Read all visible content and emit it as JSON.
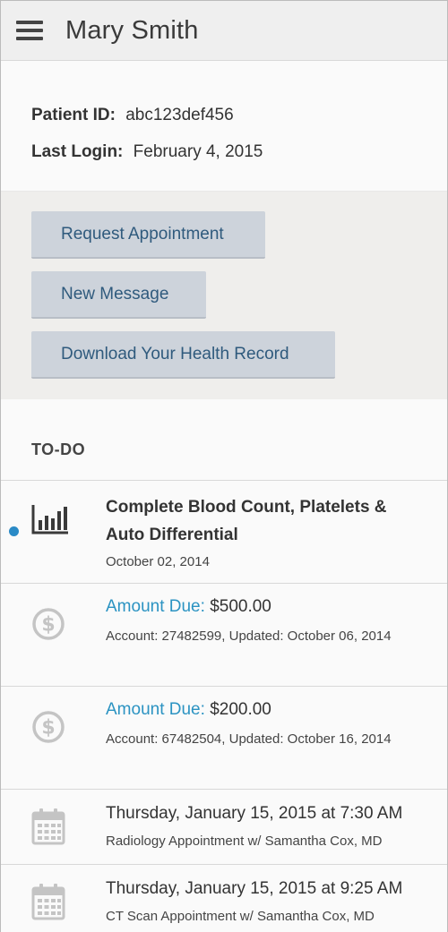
{
  "header": {
    "title": "Mary Smith",
    "menu_icon": "hamburger-menu-icon"
  },
  "patient": {
    "id_label": "Patient ID:",
    "id_value": "abc123def456",
    "login_label": "Last Login:",
    "login_value": "February 4, 2015"
  },
  "actions": {
    "request_appointment": "Request Appointment",
    "new_message": "New Message",
    "download_record": "Download Your Health Record"
  },
  "todo": {
    "heading": "TO-DO",
    "items": [
      {
        "icon": "bar-chart-icon",
        "title_line1": "Complete Blood Count, Platelets &",
        "title_line2": "Auto Differential",
        "date": "October 02, 2014",
        "unread": true
      },
      {
        "icon": "dollar-icon",
        "amount_label": "Amount Due:",
        "amount_value": "$500.00",
        "detail": "Account: 27482599, Updated: October 06, 2014"
      },
      {
        "icon": "dollar-icon",
        "amount_label": "Amount Due:",
        "amount_value": "$200.00",
        "detail": "Account: 67482504, Updated: October 16, 2014"
      },
      {
        "icon": "calendar-icon",
        "date": "Thursday, January 15, 2015 at 7:30 AM",
        "desc": "Radiology Appointment w/ Samantha Cox, MD"
      },
      {
        "icon": "calendar-icon",
        "date": "Thursday, January 15, 2015 at 9:25 AM",
        "desc": "CT Scan Appointment w/ Samantha Cox, MD"
      }
    ]
  },
  "colors": {
    "accent_link": "#2b93c2",
    "button_bg": "#cdd3db",
    "button_text": "#2f5a7d",
    "unread_dot": "#2a8ac6"
  }
}
